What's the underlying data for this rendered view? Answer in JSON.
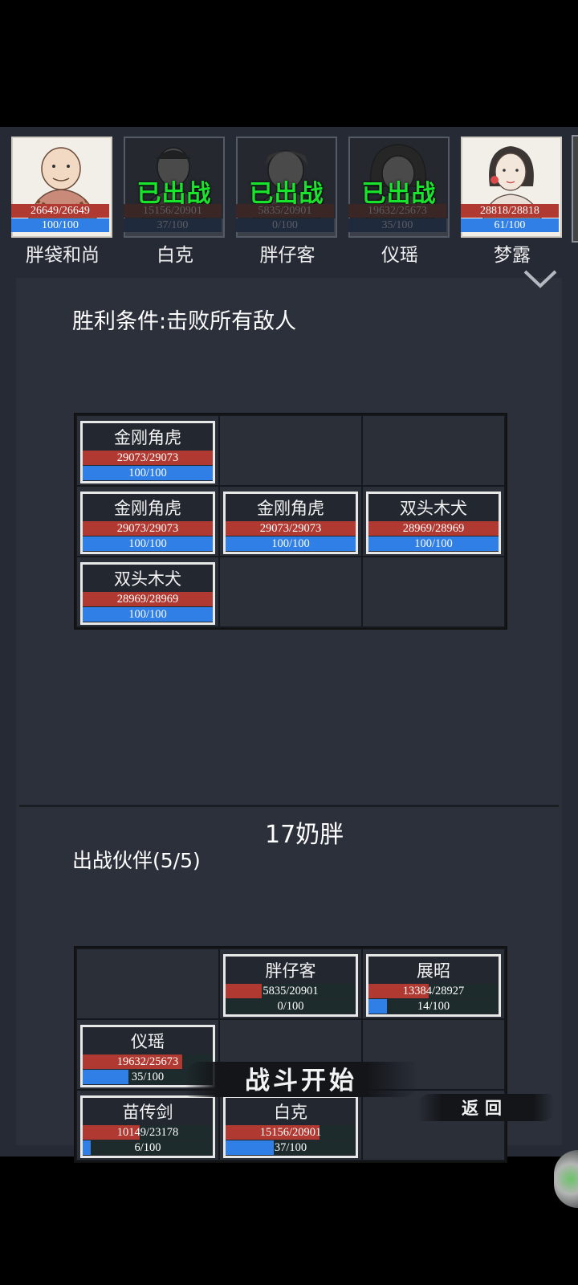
{
  "roster": [
    {
      "name": "胖袋和尚",
      "hp": "26649/26649",
      "mp": "100/100",
      "deployed": false,
      "portrait": "monk-portrait"
    },
    {
      "name": "白克",
      "hp": "15156/20901",
      "mp": "37/100",
      "deployed": true,
      "portrait": "young-man-portrait"
    },
    {
      "name": "胖仔客",
      "hp": "5835/20901",
      "mp": "0/100",
      "deployed": true,
      "portrait": "headscarf-portrait"
    },
    {
      "name": "仪瑶",
      "hp": "19632/25673",
      "mp": "35/100",
      "deployed": true,
      "portrait": "hooded-portrait"
    },
    {
      "name": "梦露",
      "hp": "28818/28818",
      "mp": "61/100",
      "deployed": false,
      "portrait": "lady-portrait"
    }
  ],
  "deployed_label": "已出战",
  "victory_condition": "胜利条件:击败所有敌人",
  "enemies": {
    "rows": [
      [
        {
          "name": "金刚角虎",
          "hp": "29073/29073",
          "mp": "100/100",
          "hp_frac": 1.0,
          "mp_frac": 1.0
        },
        null,
        null
      ],
      [
        {
          "name": "金刚角虎",
          "hp": "29073/29073",
          "mp": "100/100",
          "hp_frac": 1.0,
          "mp_frac": 1.0
        },
        {
          "name": "金刚角虎",
          "hp": "29073/29073",
          "mp": "100/100",
          "hp_frac": 1.0,
          "mp_frac": 1.0
        },
        {
          "name": "双头木犬",
          "hp": "28969/28969",
          "mp": "100/100",
          "hp_frac": 1.0,
          "mp_frac": 1.0
        }
      ],
      [
        {
          "name": "双头木犬",
          "hp": "28969/28969",
          "mp": "100/100",
          "hp_frac": 1.0,
          "mp_frac": 1.0
        },
        null,
        null
      ]
    ]
  },
  "player_name": "17奶胖",
  "partners_title": "出战伙伴(5/5)",
  "partners": {
    "rows": [
      [
        null,
        {
          "name": "胖仔客",
          "hp": "5835/20901",
          "mp": "0/100",
          "hp_frac": 0.279,
          "mp_frac": 0.0
        },
        {
          "name": "展昭",
          "hp": "13384/28927",
          "mp": "14/100",
          "hp_frac": 0.463,
          "mp_frac": 0.14
        }
      ],
      [
        {
          "name": "仪瑶",
          "hp": "19632/25673",
          "mp": "35/100",
          "hp_frac": 0.765,
          "mp_frac": 0.35
        },
        null,
        null
      ],
      [
        {
          "name": "苗传剑",
          "hp": "10149/23178",
          "mp": "6/100",
          "hp_frac": 0.438,
          "mp_frac": 0.06
        },
        {
          "name": "白克",
          "hp": "15156/20901",
          "mp": "37/100",
          "hp_frac": 0.725,
          "mp_frac": 0.37
        },
        null
      ]
    ]
  },
  "start_button": "战斗开始",
  "back_button": "返回",
  "colors": {
    "hp": "#b03a31",
    "mp": "#2f7fe6",
    "deployed": "#19e32c",
    "panel": "#2b303a"
  }
}
